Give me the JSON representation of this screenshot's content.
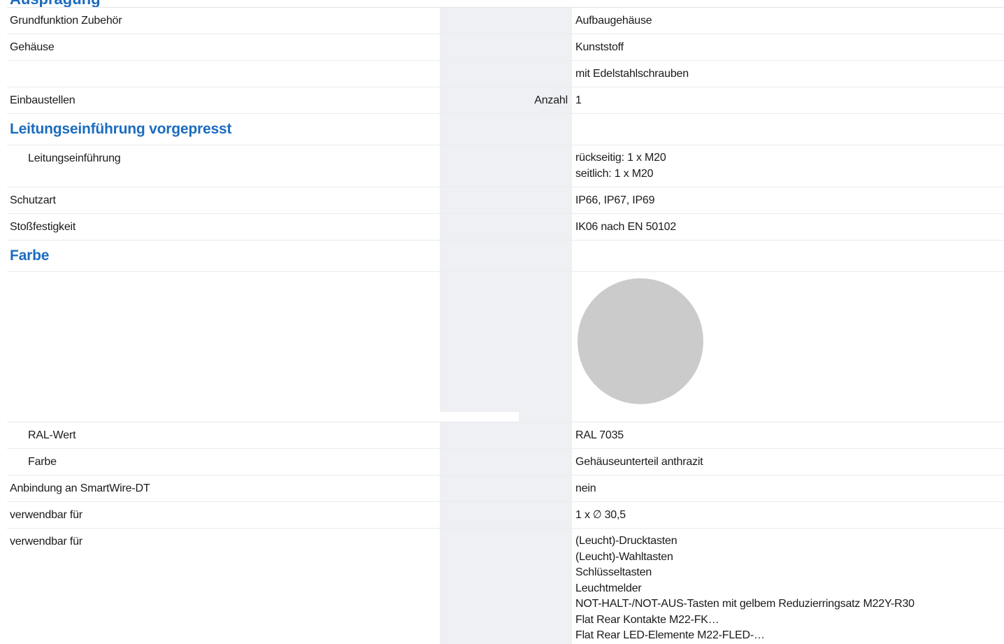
{
  "top_heading_partial": "Ausprägung",
  "swatch_color": "#cbcbcb",
  "rows": [
    {
      "label": "Grundfunktion Zubehör",
      "unit": "",
      "value": "Aufbaugehäuse"
    },
    {
      "label": "Gehäuse",
      "unit": "",
      "value": "Kunststoff"
    },
    {
      "label": "",
      "unit": "",
      "value": "mit Edelstahlschrauben"
    },
    {
      "label": "Einbaustellen",
      "unit": "Anzahl",
      "value": "1"
    },
    {
      "heading": "Leitungseinführung vorgepresst"
    },
    {
      "label": "Leitungseinführung",
      "unit": "",
      "values": [
        "rückseitig: 1 x M20",
        "seitlich: 1 x M20"
      ]
    },
    {
      "label": "Schutzart",
      "unit": "",
      "value": "IP66, IP67, IP69"
    },
    {
      "label": "Stoßfestigkeit",
      "unit": "",
      "value": "IK06 nach EN 50102"
    },
    {
      "heading": "Farbe"
    },
    {
      "label": "RAL-Wert",
      "unit": "",
      "value": "RAL 7035"
    },
    {
      "label": "Farbe",
      "unit": "",
      "value": "Gehäuseunterteil anthrazit"
    },
    {
      "label": "Anbindung an SmartWire-DT",
      "unit": "",
      "value": "nein"
    },
    {
      "label": "verwendbar für",
      "unit": "",
      "value": "1 x ∅ 30,5"
    },
    {
      "label": "verwendbar für",
      "unit": "",
      "values": [
        "(Leucht)-Drucktasten",
        "(Leucht)-Wahltasten",
        "Schlüsseltasten",
        "Leuchtmelder",
        "NOT-HALT-/NOT-AUS-Tasten mit gelbem Reduzierringsatz M22Y-R30",
        "Flat Rear Kontakte M22-FK…",
        "Flat Rear LED-Elemente M22-FLED-…"
      ]
    }
  ]
}
